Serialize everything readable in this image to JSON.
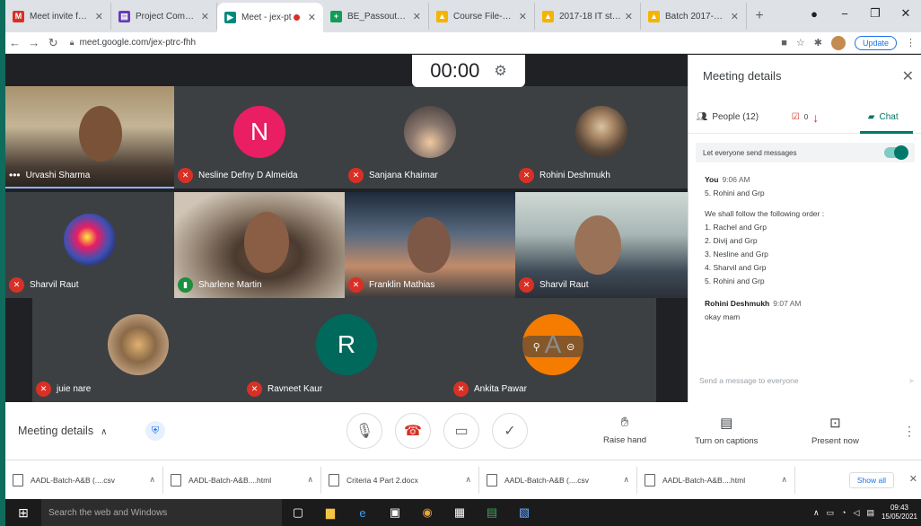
{
  "browser": {
    "tabs": [
      {
        "title": "Meet invite for P",
        "icon": "gmail-icon",
        "color": "#d93025",
        "glyph": "M"
      },
      {
        "title": "Project Competi",
        "icon": "forms-icon",
        "color": "#673ab7",
        "glyph": "▤"
      },
      {
        "title": "Meet - jex-pt",
        "icon": "meet-icon",
        "color": "#00897b",
        "glyph": "▶",
        "active": true,
        "recording": true
      },
      {
        "title": "BE_Passout_19-2",
        "icon": "sheets-icon",
        "color": "#0f9d58",
        "glyph": "+"
      },
      {
        "title": "Course File-2020",
        "icon": "drive-icon",
        "color": "#f4b400",
        "glyph": "▲"
      },
      {
        "title": "2017-18 IT stude",
        "icon": "drive-icon",
        "color": "#f4b400",
        "glyph": "▲"
      },
      {
        "title": "Batch 2017-2018",
        "icon": "drive-icon",
        "color": "#f4b400",
        "glyph": "▲"
      }
    ],
    "url": "meet.google.com/jex-ptrc-fhh",
    "update_label": "Update"
  },
  "meeting": {
    "timer": "00:00",
    "participants": [
      {
        "name": "Urvashi Sharma",
        "kind": "cam",
        "speaking": true
      },
      {
        "name": "Nesline Defny D Almeida",
        "kind": "avatar",
        "initial": "N",
        "color": "#e91e63"
      },
      {
        "name": "Sanjana Khaimar",
        "kind": "photo"
      },
      {
        "name": "Rohini Deshmukh",
        "kind": "photo"
      },
      {
        "name": "Sharvil Raut",
        "kind": "photo"
      },
      {
        "name": "Sharlene Martin",
        "kind": "cam"
      },
      {
        "name": "Franklin Mathias",
        "kind": "cam"
      },
      {
        "name": "Sharvil Raut",
        "kind": "cam"
      },
      {
        "name": "juie nare",
        "kind": "photo"
      },
      {
        "name": "Ravneet Kaur",
        "kind": "avatar",
        "initial": "R",
        "color": "#00695c"
      },
      {
        "name": "Ankita Pawar",
        "kind": "avatar",
        "initial": "A",
        "color": "#f57c00"
      }
    ]
  },
  "panel": {
    "title": "Meeting details",
    "people_label": "People (12)",
    "tasks_count": "0",
    "chat_label": "Chat",
    "toggle_label": "Let everyone send messages",
    "messages": [
      {
        "sender": "You",
        "time": "9:06 AM",
        "lines": [
          "5. Rohini and Grp",
          "",
          "We shall follow the following order :",
          "1. Rachel and Grp",
          "2. Divij and Grp",
          "3. Nesline and Grp",
          "4. Sharvil and Grp",
          "5. Rohini and Grp"
        ]
      },
      {
        "sender": "Rohini Deshmukh",
        "time": "9:07 AM",
        "lines": [
          "okay mam"
        ]
      }
    ],
    "composer_placeholder": "Send a message to everyone"
  },
  "controls": {
    "meeting_details": "Meeting details",
    "raise_hand": "Raise hand",
    "captions": "Turn on captions",
    "present": "Present now"
  },
  "downloads": {
    "items": [
      {
        "name": "AADL-Batch-A&B (....csv",
        "icon": "sheets-file-icon"
      },
      {
        "name": "AADL-Batch-A&B....html",
        "icon": "file-icon"
      },
      {
        "name": "Criteria 4 Part 2.docx",
        "icon": "word-file-icon"
      },
      {
        "name": "AADL-Batch-A&B (....csv",
        "icon": "sheets-file-icon"
      },
      {
        "name": "AADL-Batch-A&B....html",
        "icon": "file-icon"
      }
    ],
    "show_all": "Show all"
  },
  "taskbar": {
    "search_placeholder": "Search the web and Windows",
    "time": "09:43",
    "date": "15/05/2021"
  }
}
